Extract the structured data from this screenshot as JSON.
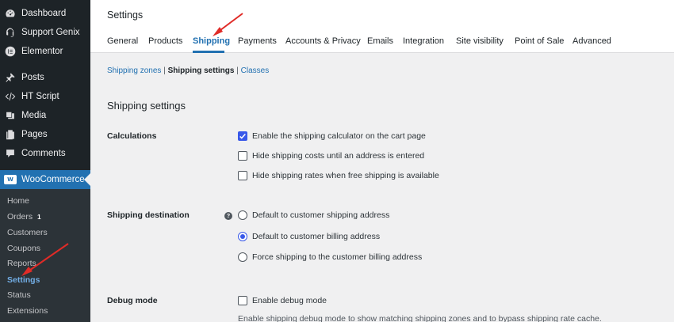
{
  "sidebar": {
    "items": [
      {
        "label": "Dashboard",
        "icon": "dashboard-icon"
      },
      {
        "label": "Support Genix",
        "icon": "support-icon"
      },
      {
        "label": "Elementor",
        "icon": "elementor-icon"
      },
      {
        "label": "Posts",
        "icon": "pin-icon"
      },
      {
        "label": "HT Script",
        "icon": "code-icon"
      },
      {
        "label": "Media",
        "icon": "media-icon"
      },
      {
        "label": "Pages",
        "icon": "pages-icon"
      },
      {
        "label": "Comments",
        "icon": "comments-icon"
      }
    ],
    "woocommerce": {
      "label": "WooCommerce",
      "icon_text": "W"
    },
    "submenu": [
      {
        "label": "Home"
      },
      {
        "label": "Orders",
        "badge": "1"
      },
      {
        "label": "Customers"
      },
      {
        "label": "Coupons"
      },
      {
        "label": "Reports"
      },
      {
        "label": "Settings",
        "current": true
      },
      {
        "label": "Status"
      },
      {
        "label": "Extensions"
      }
    ]
  },
  "header": {
    "title": "Settings",
    "tabs": [
      {
        "label": "General"
      },
      {
        "label": "Products"
      },
      {
        "label": "Shipping",
        "active": true
      },
      {
        "label": "Payments"
      },
      {
        "label": "Accounts & Privacy"
      },
      {
        "label": "Emails"
      },
      {
        "label": "Integration"
      },
      {
        "label": "Site visibility"
      },
      {
        "label": "Point of Sale"
      },
      {
        "label": "Advanced"
      }
    ]
  },
  "subnav": {
    "zones": "Shipping zones",
    "sep1": "|",
    "settings": "Shipping settings",
    "sep2": "|",
    "classes": "Classes"
  },
  "main": {
    "section_title": "Shipping settings",
    "calculations": {
      "label": "Calculations",
      "options": [
        {
          "label": "Enable the shipping calculator on the cart page",
          "checked": true
        },
        {
          "label": "Hide shipping costs until an address is entered",
          "checked": false
        },
        {
          "label": "Hide shipping rates when free shipping is available",
          "checked": false
        }
      ]
    },
    "destination": {
      "label": "Shipping destination",
      "help": "?",
      "options": [
        {
          "label": "Default to customer shipping address",
          "selected": false
        },
        {
          "label": "Default to customer billing address",
          "selected": true
        },
        {
          "label": "Force shipping to the customer billing address",
          "selected": false
        }
      ]
    },
    "debug": {
      "label": "Debug mode",
      "option": {
        "label": "Enable debug mode",
        "checked": false
      },
      "description": "Enable shipping debug mode to show matching shipping zones and to bypass shipping rate cache."
    }
  },
  "colors": {
    "accent": "#2271b1",
    "sidebar_bg": "#1d2327",
    "submenu_bg": "#2c3338",
    "checkbox_blue": "#3858e9",
    "annotation_arrow": "#e02b27"
  }
}
